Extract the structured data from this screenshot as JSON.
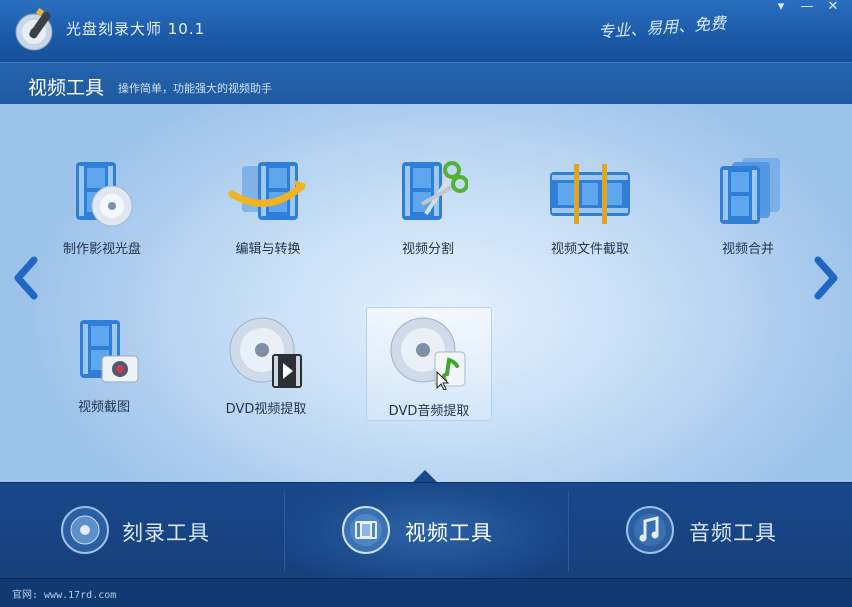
{
  "window": {
    "app_title": "光盘刻录大师 10.1",
    "slogan": "专业、易用、免费",
    "controls": {
      "menu": "▾",
      "minimize": "—",
      "close": "✕"
    }
  },
  "section": {
    "title": "视频工具",
    "subtitle": "操作简单，功能强大的视频助手"
  },
  "tools": [
    {
      "id": "make-video-disc",
      "label": "制作影视光盘",
      "icon": "film-disc-icon"
    },
    {
      "id": "edit-convert",
      "label": "编辑与转换",
      "icon": "film-arrow-icon"
    },
    {
      "id": "video-split",
      "label": "视频分割",
      "icon": "film-scissors-icon"
    },
    {
      "id": "video-clip",
      "label": "视频文件截取",
      "icon": "film-strip-cut-icon"
    },
    {
      "id": "video-merge",
      "label": "视频合并",
      "icon": "film-stack-icon"
    },
    {
      "id": "video-snapshot",
      "label": "视频截图",
      "icon": "film-camera-icon"
    },
    {
      "id": "dvd-video-extract",
      "label": "DVD视频提取",
      "icon": "dvd-video-icon"
    },
    {
      "id": "dvd-audio-extract",
      "label": "DVD音频提取",
      "icon": "dvd-music-icon",
      "hover": true
    }
  ],
  "tabs": [
    {
      "label": "刻录工具",
      "icon": "disc-icon"
    },
    {
      "label": "视频工具",
      "icon": "film-icon",
      "active": true
    },
    {
      "label": "音频工具",
      "icon": "music-note-icon"
    }
  ],
  "status": {
    "text": "官网: www.17rd.com"
  },
  "colors": {
    "accent": "#1b5aa8",
    "tab_bar": "#19488a",
    "film_blue": "#2f7fd6"
  }
}
